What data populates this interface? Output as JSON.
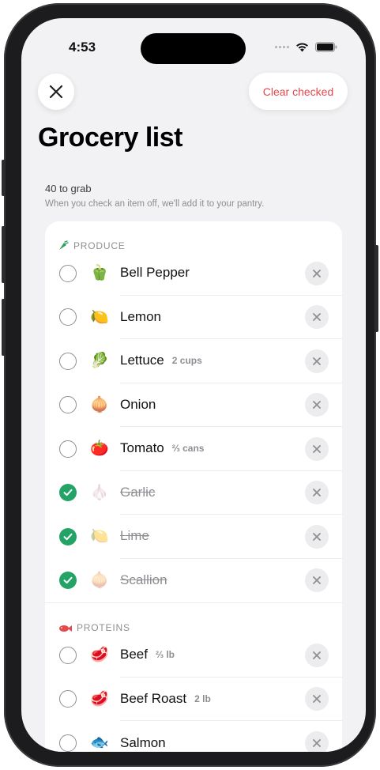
{
  "status_bar": {
    "time": "4:53"
  },
  "header": {
    "close_icon": "close-icon",
    "clear_label": "Clear checked",
    "title": "Grocery list"
  },
  "summary": {
    "count_text": "40 to grab",
    "hint": "When you check an item off, we'll add it to your pantry."
  },
  "colors": {
    "accent_red": "#e5484d",
    "check_green": "#23a365"
  },
  "sections": [
    {
      "label": "PRODUCE",
      "icon": "carrot-icon",
      "items": [
        {
          "name": "Bell Pepper",
          "emoji": "🫑",
          "qty": "",
          "checked": false
        },
        {
          "name": "Lemon",
          "emoji": "🍋",
          "qty": "",
          "checked": false
        },
        {
          "name": "Lettuce",
          "emoji": "🥬",
          "qty": "2 cups",
          "checked": false
        },
        {
          "name": "Onion",
          "emoji": "🧅",
          "qty": "",
          "checked": false
        },
        {
          "name": "Tomato",
          "emoji": "🍅",
          "qty": "⅔ cans",
          "checked": false
        },
        {
          "name": "Garlic",
          "emoji": "🧄",
          "qty": "",
          "checked": true
        },
        {
          "name": "Lime",
          "emoji": "🍋",
          "qty": "",
          "checked": true
        },
        {
          "name": "Scallion",
          "emoji": "🧅",
          "qty": "",
          "checked": true
        }
      ]
    },
    {
      "label": "PROTEINS",
      "icon": "fish-icon",
      "items": [
        {
          "name": "Beef",
          "emoji": "🥩",
          "qty": "⅔ lb",
          "checked": false
        },
        {
          "name": "Beef Roast",
          "emoji": "🥩",
          "qty": "2 lb",
          "checked": false
        },
        {
          "name": "Salmon",
          "emoji": "🐟",
          "qty": "",
          "checked": false
        }
      ]
    }
  ]
}
